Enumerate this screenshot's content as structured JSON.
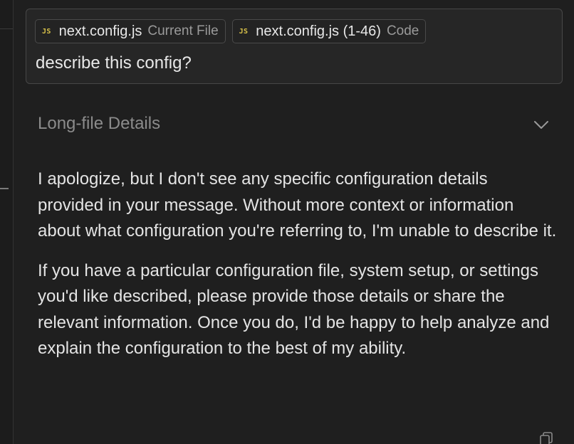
{
  "context_chips": [
    {
      "badge": "JS",
      "filename": "next.config.js",
      "context": "Current File"
    },
    {
      "badge": "JS",
      "filename": "next.config.js (1-46)",
      "context": "Code"
    }
  ],
  "query": "describe this config?",
  "details": {
    "label": "Long-file Details",
    "expanded": false
  },
  "response": {
    "paragraphs": [
      "I apologize, but I don't see any specific configuration details provided in your message. Without more context or information about what configuration you're referring to, I'm unable to describe it.",
      "If you have a particular configuration file, system setup, or settings you'd like described, please provide those details or share the relevant information. Once you do, I'd be happy to help analyze and explain the configuration to the best of my ability."
    ]
  },
  "icons": {
    "chevron": "chevron-down-icon",
    "copy": "copy-icon",
    "js_badge": "js-file-icon"
  },
  "colors": {
    "background": "#1f1f1f",
    "input_background": "#262626",
    "js_badge": "#d9c24a",
    "muted_text": "#8b8b8b"
  }
}
